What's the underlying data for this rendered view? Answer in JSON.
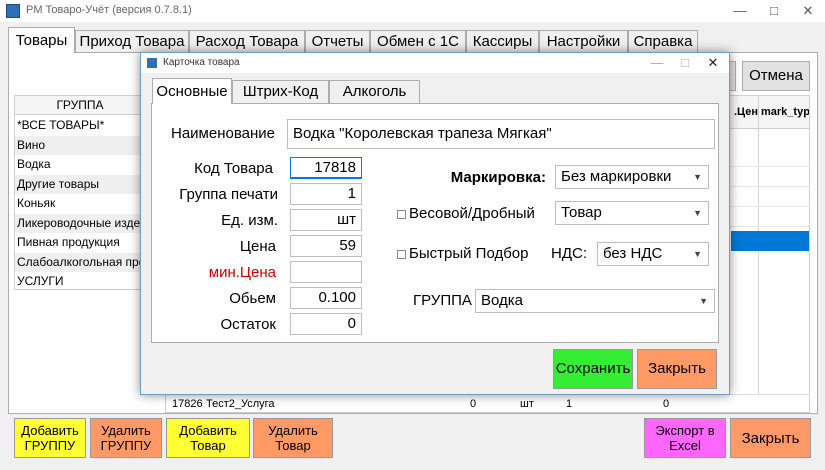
{
  "window": {
    "title": "PM Товаро-Учёт (версия 0.7.8.1)",
    "controls": [
      "—",
      "□",
      "✕"
    ]
  },
  "tabs": [
    "Товары",
    "Приход Товара",
    "Расход Товара",
    "Отчеты",
    "Обмен с 1С",
    "Кассиры",
    "Настройки",
    "Справка"
  ],
  "top_buttons": {
    "partial": "е",
    "cancel": "Отмена"
  },
  "groups": {
    "header": "ГРУППА",
    "items": [
      "*ВСЕ ТОВАРЫ*",
      "Вино",
      "Водка",
      "Другие товары",
      "Коньяк",
      "Ликероводочные изде",
      "Пивная продукция",
      "Слабоалкогольная про",
      "УСЛУГИ"
    ]
  },
  "products": {
    "header_partial": ".Цен",
    "header_col": "mark_typ",
    "last_row": {
      "code": "17826",
      "name": "Тест2_Услуга",
      "price": "0",
      "unit": "шт",
      "qty": "1",
      "rest": "0"
    }
  },
  "bottom_buttons": {
    "add_group": "Добавить ГРУППУ",
    "delete_group": "Удалить ГРУППУ",
    "add_product": "Добавить Товар",
    "delete_product": "Удалить Товар",
    "export_excel": "Экспорт в Excel",
    "close": "Закрыть"
  },
  "dialog": {
    "title": "Карточка товара",
    "tabs": [
      "Основные",
      "Штрих-Код",
      "Алкоголь"
    ],
    "name_label": "Наименование",
    "name_value": "Водка \"Королевская трапеза Мягкая\"",
    "fields": [
      {
        "label": "Код Товара",
        "value": "17818"
      },
      {
        "label": "Группа печати",
        "value": "1"
      },
      {
        "label": "Ед. изм.",
        "value": "шт"
      },
      {
        "label": "Цена",
        "value": "59"
      },
      {
        "label": "мин.Цена",
        "value": ""
      },
      {
        "label": "Обьем",
        "value": "0.100"
      },
      {
        "label": "Остаток",
        "value": "0"
      }
    ],
    "marking_label": "Маркировка:",
    "marking_value": "Без маркировки",
    "weight_label": "Весовой/Дробный",
    "weight_value": "Товар",
    "quick_label": "Быстрый Подбор",
    "vat_label": "НДС:",
    "vat_value": "без НДС",
    "group_label": "ГРУППА",
    "group_value": "Водка",
    "save": "Сохранить",
    "close": "Закрыть",
    "min_price_color": "#cc0000"
  }
}
